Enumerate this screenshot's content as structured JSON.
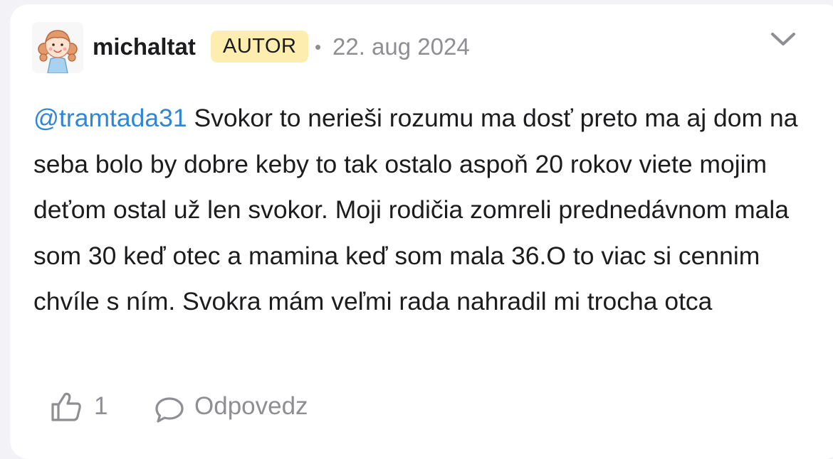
{
  "comment": {
    "author": "michaltat",
    "badge": "AUTOR",
    "separator": "•",
    "date": "22. aug 2024",
    "mention": "@tramtada31",
    "text": " Svokor to nerieši rozumu ma dosť preto ma aj dom na seba bolo by dobre keby to tak ostalo aspoň 20 rokov viete mojim deťom ostal už len svokor. Moji rodičia zomreli prednedávnom mala som 30 keď otec a mamina keď som mala 36.O to viac si cennim chvíle s ním. Svokra mám veľmi rada nahradil mi trocha otca",
    "avatar_icon": "girl-cartoon-avatar",
    "menu_icon": "chevron-down-icon"
  },
  "actions": {
    "like_icon": "thumbs-up-icon",
    "like_count": "1",
    "reply_icon": "speech-bubble-icon",
    "reply_label": "Odpovedz"
  },
  "colors": {
    "badge_bg": "#fdeeb0",
    "mention": "#2f86d6",
    "muted": "#8e8e93",
    "text": "#1c1c1e"
  }
}
